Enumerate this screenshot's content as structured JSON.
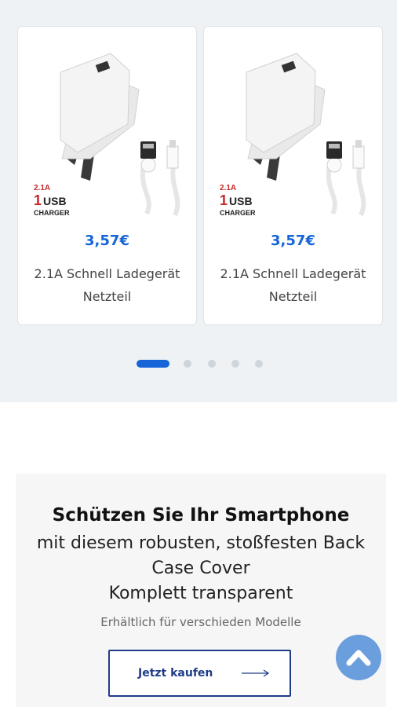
{
  "products": [
    {
      "price": "3,57€",
      "title": "2.1A Schnell Ladegerät Netzteil",
      "image_text": "2.1A 1 USB CHARGER"
    },
    {
      "price": "3,57€",
      "title": "2.1A Schnell Ladegerät Netzteil",
      "image_text": "2.1A 1 USB CHARGER"
    }
  ],
  "carousel": {
    "active_index": 1,
    "total": 5
  },
  "promo": {
    "heading": "Schützen Sie Ihr Smartphone",
    "subline": "mit diesem robusten, stoßfesten Back Case Cover\nKomplett transparent",
    "availability": "Erhältlich für verschieden Modelle",
    "button_label": "Jetzt kaufen"
  },
  "colors": {
    "accent": "#1565d8",
    "button_border": "#1f3c88",
    "scroll_top": "#6a9edd"
  },
  "icons": {
    "scroll_top": "chevron-up-icon",
    "button_arrow": "arrow-right-icon"
  }
}
